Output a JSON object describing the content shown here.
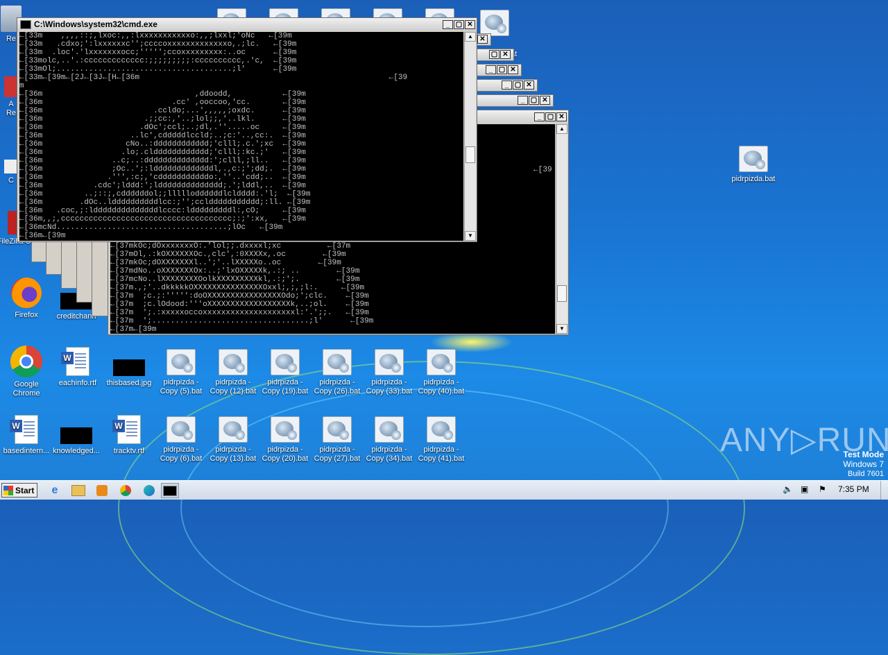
{
  "desktop": {
    "left_icons": [
      {
        "label": "Re",
        "kind": "partial"
      },
      {
        "label": "A\nRe",
        "kind": "partial"
      },
      {
        "label": "C",
        "kind": "partial"
      },
      {
        "label": "FileZilla C",
        "kind": "partial"
      },
      {
        "label": "Firefox",
        "kind": "firefox"
      },
      {
        "label": "creditchann",
        "kind": "black"
      },
      {
        "label": "Google Chrome",
        "kind": "chrome"
      },
      {
        "label": "eachinfo.rtf",
        "kind": "doc"
      },
      {
        "label": "thisbased.jpg",
        "kind": "black"
      },
      {
        "label": "basedintern...",
        "kind": "doc"
      },
      {
        "label": "knowledged...",
        "kind": "black"
      },
      {
        "label": "tracktv.rtf",
        "kind": "doc"
      }
    ],
    "bat_row1": [
      {
        "label": "pidrpizda - Copy (5).bat"
      },
      {
        "label": "pidrpizda - Copy (12).bat"
      },
      {
        "label": "pidrpizda - Copy (19).bat"
      },
      {
        "label": "pidrpizda - Copy (26).bat"
      },
      {
        "label": "pidrpizda - Copy (33).bat"
      },
      {
        "label": "pidrpizda - Copy (40).bat"
      }
    ],
    "bat_row2": [
      {
        "label": "pidrpizda - Copy (6).bat"
      },
      {
        "label": "pidrpizda - Copy (13).bat"
      },
      {
        "label": "pidrpizda - Copy (20).bat"
      },
      {
        "label": "pidrpizda - Copy (27).bat"
      },
      {
        "label": "pidrpizda - Copy (34).bat"
      },
      {
        "label": "pidrpizda - Copy (41).bat"
      }
    ],
    "right_icon": {
      "label": "pidrpizda.bat"
    },
    "partial_top_label": "bat"
  },
  "main_window": {
    "title": "C:\\Windows\\system32\\cmd.exe",
    "console_text": "←[33m    ,,,,::;,lxoc:,,:lxxxxxxxxxxxo:,,;lxxl;'oNc   ←[39m\n←[33m   .cdxo;':lxxxxxxc'';ccccoxxxxxxxxxxxxxo,.;lc.   ←[39m\n←[33m  .loc'.'lxxxxxxxocc;''''';ccoxxxxxxxxx:..oc      ←[39m\n←[33molc,..'.:ccccccccccccc:;;;;;;;;;:cccccccccc,.'c,  ←[39m\n←[33mOl;......................................;l'      ←[39m\n←[33m←[39m←[2J←[3J←[H←[36m                                                      ←[39\nm\n←[36m                                 ,ddoodd,           ←[39m\n←[36m                            .cc' ,ooccoo,'cc.       ←[39m\n←[36m                        .ccldo;...',,,,,;oxdc.      ←[39m\n←[36m                      .;;cc:,'..;lol;;,'..lkl.      ←[39m\n←[36m                     .dOc';ccl;..;dl,.''.....oc     ←[39m\n←[36m                   ..lc',cdddddlccld;..;c:'..,cc:.  ←[39m\n←[36m                  cNo..:dddddddddddd;'clll;.c.';xc  ←[39m\n←[36m                 .lo;.cldddddddddddd;'clll;:kc.;'   ←[39m\n←[36m               ..c;..:dddddddddddddd:';clll,;ll..   ←[39m\n←[36m               ;Oc..';:ldddddddddddddl,.,c:;';dd;.  ←[39m\n←[36m              .''',:c;,'cdddddddddddo:,''..'cdd;..  ←[39m\n←[36m           .cdc';lddd:';ldddddddddddddd;.';lddl,..  ←[39m\n←[36m         ..;::;,cddddddol;;llllloddddddlcldddd:.'l;  ←[39m\n←[36m        .dOc..lddddddddddlcc:;'';cclddddddddddd;:ll. ←[39m\n←[36m   .coc,;:lddddddddddddddlcccc:ldddddddddl:,cO;     ←[39m\n←[36m,,;,ccccccccccccccccccccccccccccccccccccc;:;':xx,   ←[39m\n←[36mcNd.....................................;lOc   ←[39m\n←[36m←[39m"
  },
  "second_window": {
    "console_text": "←[37mkOc;dOxxxxxxxO:.'lol;;.dxxxxl;xc          ←[37m\n←[37mOl,.:kOXXXXXXOc.,clc',:0XXXXx,.oc        ←[39m\n←[37mkOc;dOXXXXXXXl..';'..lXXXXXo..oc        ←[39m\n←[37mdNo..oXXXXXXXOx:..;'lxOXXXXXk,.:; ..        ←[39m\n←[37mcNo..lXXXXXXXXOolkXXXXXXXXXkl,.:;';.        ←[39m\n←[37m.,;'..dkkkkkOXXXXXXXXXXXXXXXOxxl;,;,;l:.     ←[39m\n←[37m  ;c.;:''''':doOXXXXXXXXXXXXXXXXOdo;';clc.    ←[39m\n←[37m  ;c.lOdood:'''oXXXXXXXXXXXXXXXXXXk,..;ol.    ←[39m\n←[37m  ';.:xxxxxoccoxxxxxxxxxxxxxxxxxxxxl:'.';;.   ←[39m\n←[37m  ';..................................;l'      ←[39m\n←[37m←[39m",
    "side_text": "←[39"
  },
  "taskbar": {
    "start_label": "Start",
    "clock": "7:35 PM"
  },
  "watermark": {
    "text": "ANY▷RUN",
    "testmode_line1": "Test Mode",
    "testmode_line2": "Windows 7",
    "testmode_line3": "Build 7601"
  }
}
